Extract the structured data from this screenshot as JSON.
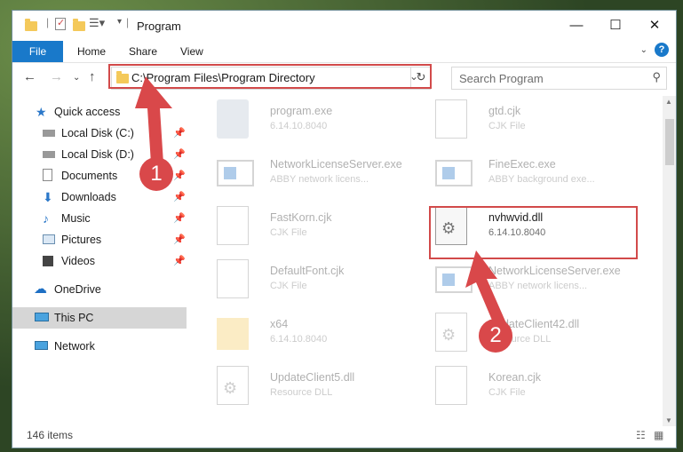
{
  "window": {
    "title": "Program",
    "minimize_icon": "minimize-icon",
    "maximize_icon": "maximize-icon",
    "close_icon": "close-icon"
  },
  "ribbon": {
    "tabs": [
      "File",
      "Home",
      "Share",
      "View"
    ],
    "help": "?"
  },
  "address": {
    "path": "C:\\Program Files\\Program Directory"
  },
  "search": {
    "placeholder": "Search Program"
  },
  "sidebar": {
    "items": [
      {
        "label": "Quick access"
      },
      {
        "label": "Local Disk (C:)"
      },
      {
        "label": "Local Disk (D:)"
      },
      {
        "label": "Documents"
      },
      {
        "label": "Downloads"
      },
      {
        "label": "Music"
      },
      {
        "label": "Pictures"
      },
      {
        "label": "Videos"
      },
      {
        "label": "OneDrive"
      },
      {
        "label": "This PC"
      },
      {
        "label": "Network"
      }
    ]
  },
  "files": [
    {
      "name": "program.exe",
      "sub": "6.14.10.8040"
    },
    {
      "name": "gtd.cjk",
      "sub": "CJK File"
    },
    {
      "name": "NetworkLicenseServer.exe",
      "sub": "ABBY network licens..."
    },
    {
      "name": "FineExec.exe",
      "sub": "ABBY background exe..."
    },
    {
      "name": "FastKorn.cjk",
      "sub": "CJK File"
    },
    {
      "name": "nvhwvid.dll",
      "sub": "6.14.10.8040"
    },
    {
      "name": "DefaultFont.cjk",
      "sub": "CJK File"
    },
    {
      "name": "NetworkLicenseServer.exe",
      "sub": "ABBY network licens..."
    },
    {
      "name": "x64",
      "sub": "6.14.10.8040"
    },
    {
      "name": "UpdateClient42.dll",
      "sub": "Resource DLL"
    },
    {
      "name": "UpdateClient5.dll",
      "sub": "Resource DLL"
    },
    {
      "name": "Korean.cjk",
      "sub": "CJK File"
    }
  ],
  "status": {
    "count": "146 items"
  },
  "markers": [
    "1",
    "2"
  ]
}
